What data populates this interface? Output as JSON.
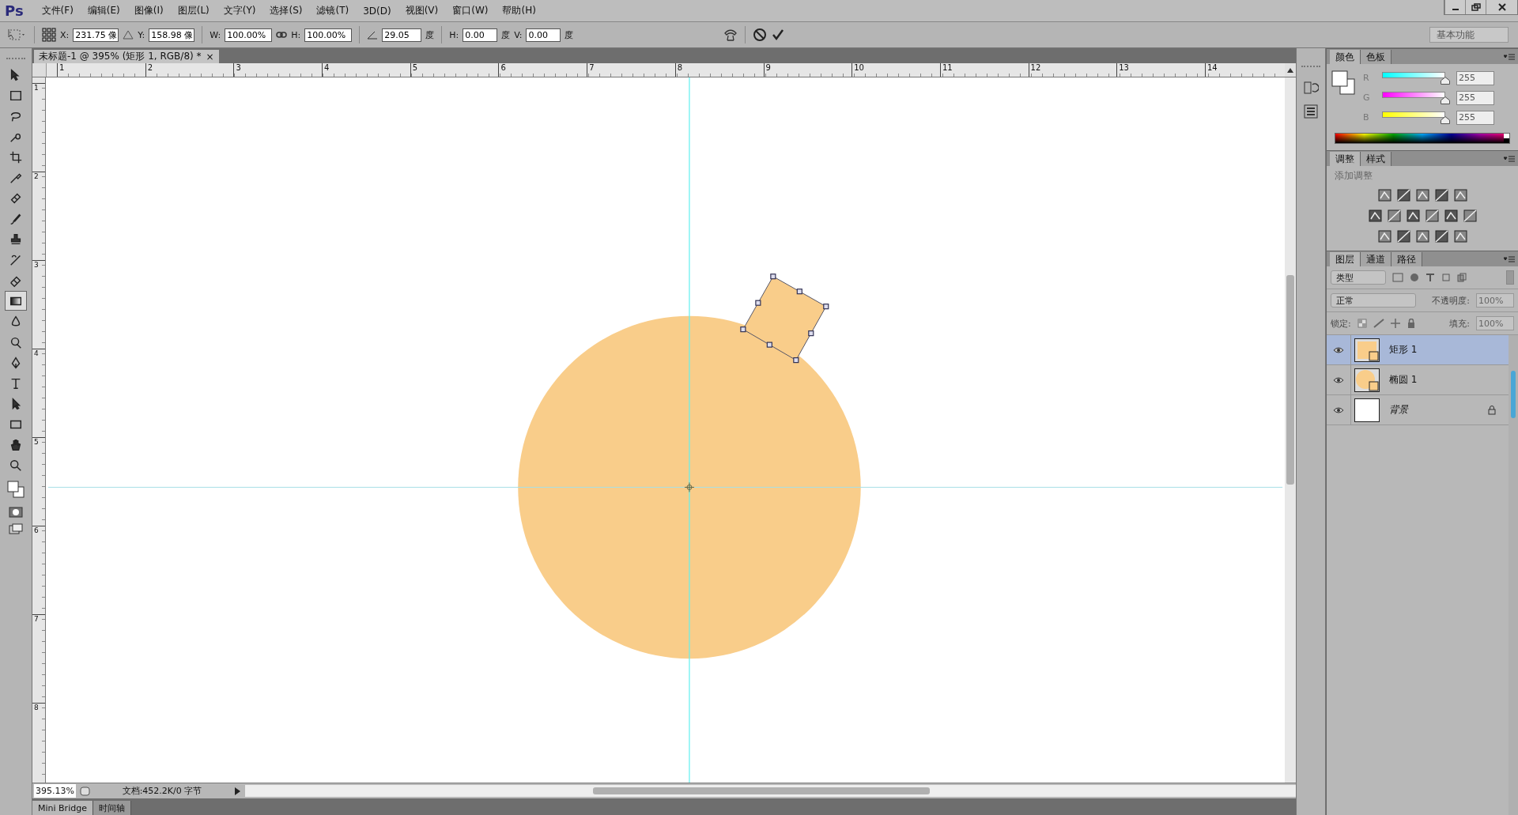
{
  "app": {
    "logo": "Ps"
  },
  "menu": [
    "文件(F)",
    "编辑(E)",
    "图像(I)",
    "图层(L)",
    "文字(Y)",
    "选择(S)",
    "滤镜(T)",
    "3D(D)",
    "视图(V)",
    "窗口(W)",
    "帮助(H)"
  ],
  "options_bar": {
    "x_label": "X:",
    "x_value": "231.75 像",
    "y_label": "Y:",
    "y_value": "158.98 像",
    "w_label": "W:",
    "w_value": "100.00%",
    "h_label": "H:",
    "h_value": "100.00%",
    "angle_value": "29.05",
    "angle_unit": "度",
    "hskew_label": "H:",
    "hskew_value": "0.00",
    "hskew_unit": "度",
    "vskew_label": "V:",
    "vskew_value": "0.00",
    "vskew_unit": "度",
    "workspace": "基本功能"
  },
  "tools": [
    {
      "kind": "move",
      "selected": false
    },
    {
      "kind": "marquee",
      "selected": false
    },
    {
      "kind": "lasso",
      "selected": false
    },
    {
      "kind": "quick-select",
      "selected": false
    },
    {
      "kind": "crop",
      "selected": false
    },
    {
      "kind": "eyedropper",
      "selected": false
    },
    {
      "kind": "healing",
      "selected": false
    },
    {
      "kind": "brush",
      "selected": false
    },
    {
      "kind": "stamp",
      "selected": false
    },
    {
      "kind": "history-brush",
      "selected": false
    },
    {
      "kind": "eraser",
      "selected": false
    },
    {
      "kind": "gradient",
      "selected": true
    },
    {
      "kind": "blur",
      "selected": false
    },
    {
      "kind": "dodge",
      "selected": false
    },
    {
      "kind": "pen",
      "selected": false
    },
    {
      "kind": "type",
      "selected": false
    },
    {
      "kind": "path-select",
      "selected": false
    },
    {
      "kind": "shape",
      "selected": false
    },
    {
      "kind": "hand",
      "selected": false
    },
    {
      "kind": "zoom",
      "selected": false
    }
  ],
  "document": {
    "tab_title": "未标题-1 @ 395% (矩形 1, RGB/8) *",
    "close": "×",
    "ruler_h": [
      "1",
      "2",
      "3",
      "4",
      "5",
      "6",
      "7",
      "8",
      "9",
      "10",
      "11",
      "12",
      "13",
      "14"
    ],
    "ruler_v": [
      "1",
      "2",
      "3",
      "4",
      "5",
      "6",
      "7",
      "8"
    ],
    "zoom": "395.13%",
    "doc_info": "文档:452.2K/0 字节"
  },
  "bottom_tabs": [
    {
      "label": "Mini Bridge",
      "selected": true
    },
    {
      "label": "时间轴",
      "selected": false
    }
  ],
  "color_panel": {
    "tabs": [
      {
        "label": "颜色",
        "selected": true
      },
      {
        "label": "色板",
        "selected": false
      }
    ],
    "channels": [
      {
        "name": "R",
        "level": 1,
        "value": "255"
      },
      {
        "name": "G",
        "level": 1,
        "value": "255"
      },
      {
        "name": "B",
        "level": 1,
        "value": "255"
      }
    ]
  },
  "adjustments_panel": {
    "tabs": [
      {
        "label": "调整",
        "selected": true
      },
      {
        "label": "样式",
        "selected": false
      }
    ],
    "title": "添加调整"
  },
  "layers_panel": {
    "tabs": [
      {
        "label": "图层",
        "selected": true
      },
      {
        "label": "通道",
        "selected": false
      },
      {
        "label": "路径",
        "selected": false
      }
    ],
    "filter": "类型",
    "blend_mode": "正常",
    "opacity_label": "不透明度:",
    "opacity": "100%",
    "lock_label": "锁定:",
    "fill_label": "填充:",
    "fill": "100%",
    "layers": [
      {
        "name": "矩形 1",
        "kind": "shape",
        "visible": true,
        "selected": true,
        "locked": false
      },
      {
        "name": "椭圆 1",
        "kind": "ellipse",
        "visible": true,
        "selected": false,
        "locked": false
      },
      {
        "name": "背景",
        "kind": "background",
        "visible": true,
        "selected": false,
        "locked": true
      }
    ]
  }
}
